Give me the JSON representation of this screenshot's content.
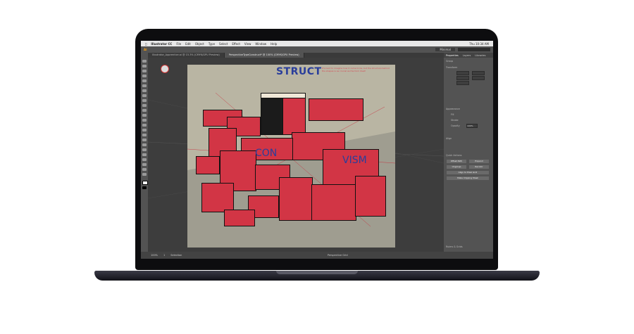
{
  "menubar": {
    "apple": "",
    "items": [
      "Illustrator CC",
      "File",
      "Edit",
      "Object",
      "Type",
      "Select",
      "Effect",
      "View",
      "Window",
      "Help"
    ],
    "clock": "Thu 10:34 AM"
  },
  "appbar": {
    "workspace": "Minimal"
  },
  "tabs": [
    {
      "label": "Illustrator_Apprentice.ai @ 15.3% (CMYK/GPU Preview)"
    },
    {
      "label": "PerspectiveTypeConstruct* @ 100% (CMYK/GPU Preview)"
    }
  ],
  "artwork": {
    "title": "STRUCT",
    "subtitle": "It's hard to imagine how it came to be, but the structure behind the shapes is as crucial as the form itself.",
    "word_con": "CON",
    "word_vism": "VISM"
  },
  "panel": {
    "tabs": [
      "Properties",
      "Layers",
      "Libraries"
    ],
    "section_selected": "Group",
    "section_transform": "Transform",
    "section_appearance": "Appearance",
    "section_align": "Align",
    "section_actions": "Quick Actions",
    "label_fill": "Fill",
    "label_stroke": "Stroke",
    "label_opacity": "Opacity",
    "opacity_value": "100%",
    "btn_offset": "Offset Path",
    "btn_expand": "Expand",
    "btn_ungroup": "Ungroup",
    "btn_recolor": "Recolor",
    "btn_align": "Align to Pixel Grid",
    "btn_make_clip": "Make Clipping Mask",
    "section_guides": "Rulers & Grids"
  },
  "statusbar": {
    "zoom": "100%",
    "artboard": "1",
    "tool": "Selection",
    "status": "Perspective Grid"
  },
  "colors": {
    "accent_red": "#d23545",
    "accent_blue": "#2a3e9b",
    "artboard_bg": "#b9b5a3"
  }
}
